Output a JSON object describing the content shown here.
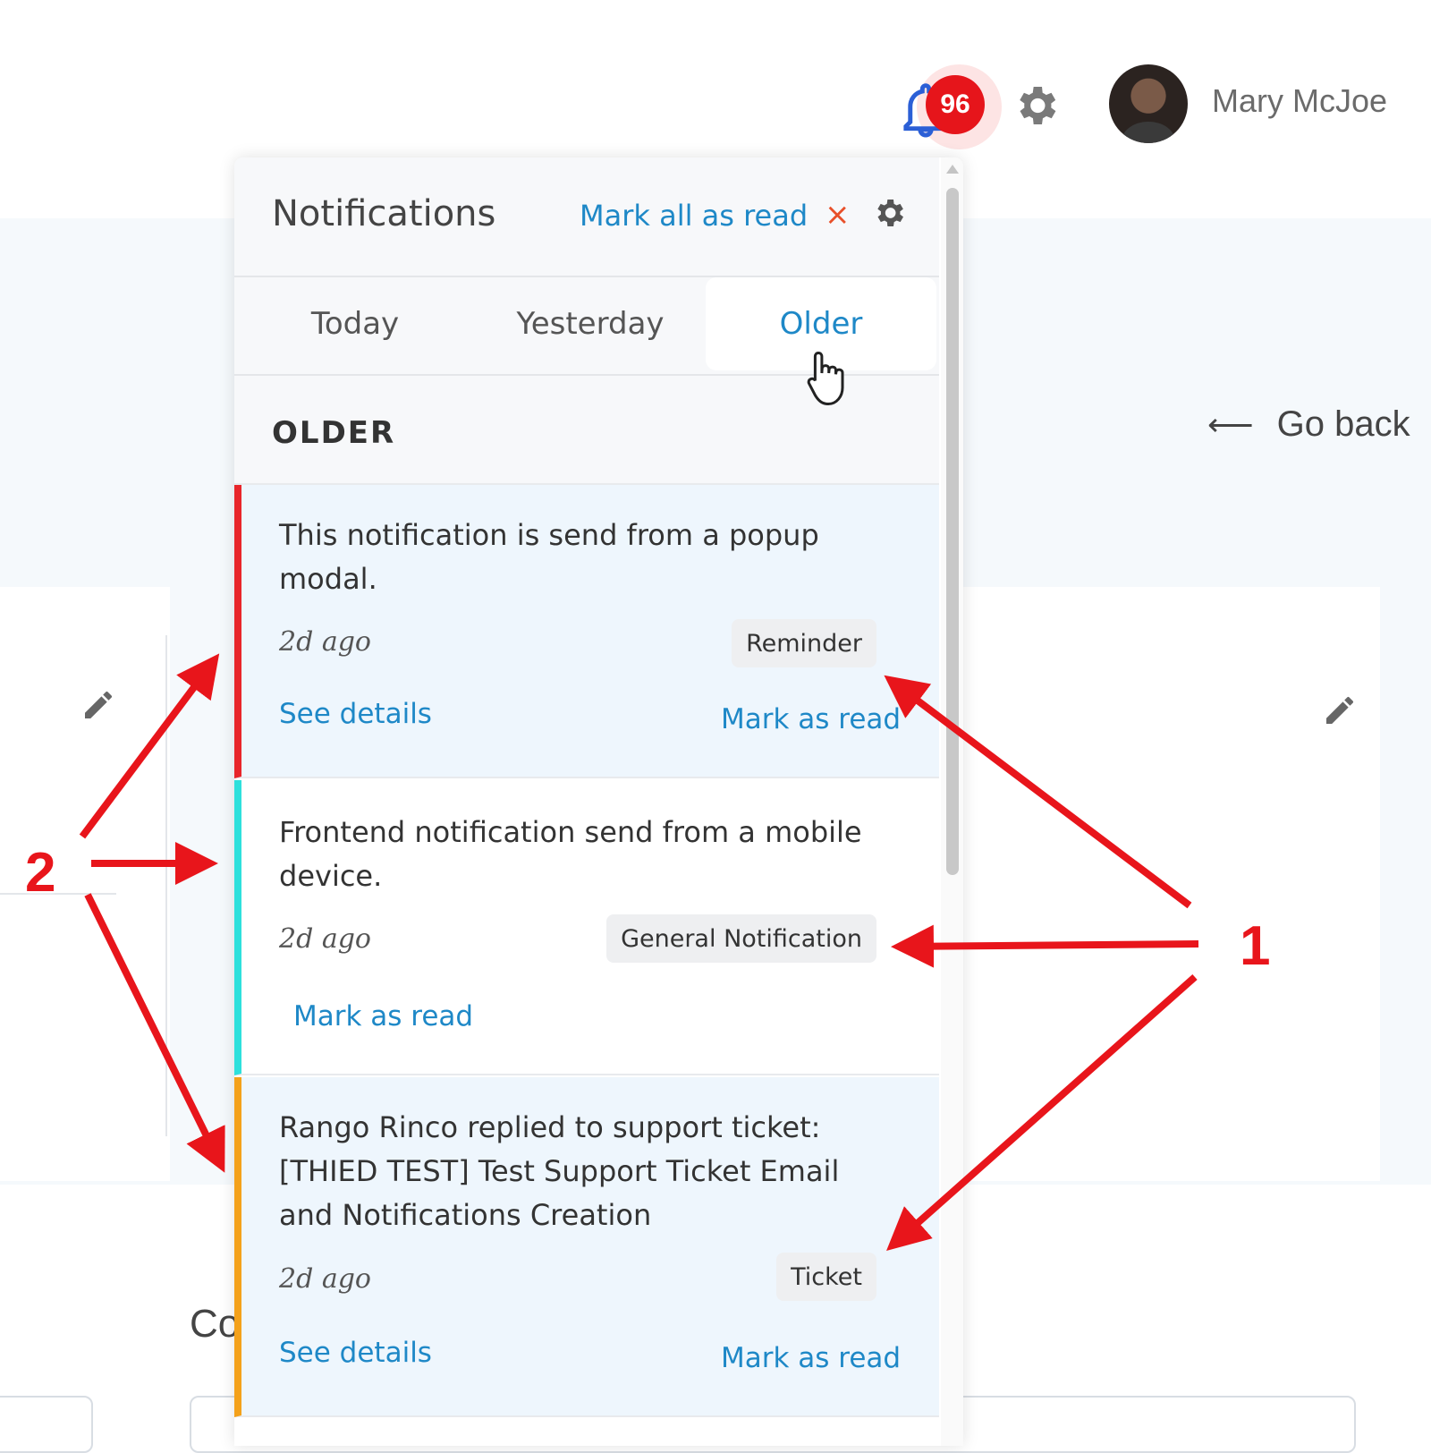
{
  "header": {
    "notification_count": "96",
    "user_name": "Mary McJoe"
  },
  "page": {
    "go_back": "Go back",
    "heading_partial": "Co"
  },
  "panel": {
    "title": "Notifications",
    "mark_all": "Mark all as read",
    "close_glyph": "×",
    "tabs": [
      {
        "label": "Today",
        "active": false
      },
      {
        "label": "Yesterday",
        "active": false
      },
      {
        "label": "Older",
        "active": true
      }
    ],
    "section_title": "OLDER",
    "items": [
      {
        "message": "This notification is send from a popup modal.",
        "time": "2d ago",
        "tag": "Reminder",
        "see_details": "See details",
        "mark_read": "Mark as read",
        "accent": "#e8252a"
      },
      {
        "message": "Frontend notification send from a mobile device.",
        "time": "2d ago",
        "tag": "General Notification",
        "mark_read": "Mark as read",
        "accent": "#2ee0dc"
      },
      {
        "message": "Rango Rinco replied to support ticket: [THIED TEST] Test Support Ticket Email and Notifications Creation",
        "time": "2d ago",
        "tag": "Ticket",
        "see_details": "See details",
        "mark_read": "Mark as read",
        "accent": "#f4a11a"
      }
    ]
  },
  "annotations": {
    "label_1": "1",
    "label_2": "2"
  },
  "colors": {
    "link": "#1e88c7",
    "badge": "#e6151b",
    "annotation": "#e8151b"
  },
  "icons": [
    "bell-icon",
    "gear-icon",
    "close-icon",
    "pencil-icon",
    "arrow-left-icon",
    "hand-cursor-icon"
  ]
}
